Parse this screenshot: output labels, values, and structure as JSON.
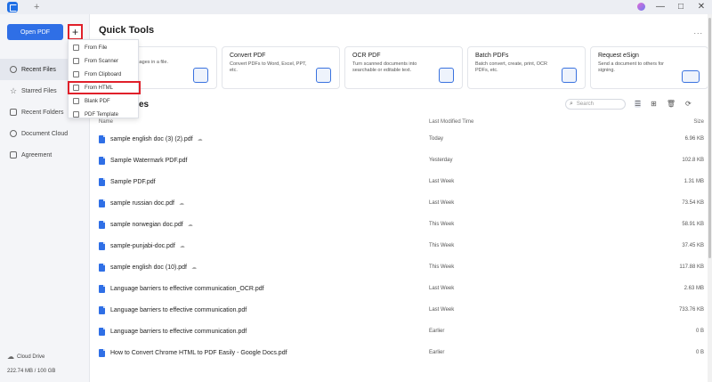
{
  "titlebar": {
    "logo_icon": "pdfelement-logo",
    "new_tab": "+",
    "win_buttons": [
      "—",
      "□",
      "✕"
    ]
  },
  "sidebar": {
    "open_pdf": "Open PDF",
    "plus": "+",
    "items": [
      {
        "label": "Recent Files",
        "icon": "clock-icon",
        "active": true
      },
      {
        "label": "Starred Files",
        "icon": "star-icon"
      },
      {
        "label": "Recent Folders",
        "icon": "folder-icon"
      },
      {
        "label": "Document Cloud",
        "icon": "cloud-icon"
      },
      {
        "label": "Agreement",
        "icon": "agreement-icon"
      }
    ],
    "cloud_drive": "Cloud Drive",
    "storage": "222.74 MB / 100 GB"
  },
  "dropdown": {
    "items": [
      "From File",
      "From Scanner",
      "From Clipboard",
      "From HTML",
      "Blank PDF",
      "PDF Template"
    ],
    "highlighted": "From HTML"
  },
  "quick_tools": {
    "title": "Quick Tools",
    "more": "...",
    "cards": [
      {
        "title": "",
        "desc": "mages in a file."
      },
      {
        "title": "Convert PDF",
        "desc": "Convert PDFs to Word, Excel, PPT, etc."
      },
      {
        "title": "OCR PDF",
        "desc": "Turn scanned documents into searchable or editable text."
      },
      {
        "title": "Batch PDFs",
        "desc": "Batch convert, create, print, OCR PDFs, etc."
      },
      {
        "title": "Request eSign",
        "desc": "Send a document to others for signing."
      }
    ]
  },
  "recent": {
    "title": "es",
    "search_placeholder": "Search",
    "columns": {
      "name": "Name",
      "modified": "Last Modified Time",
      "size": "Size"
    },
    "files": [
      {
        "name": "sample english doc (3) (2).pdf",
        "cloud": true,
        "modified": "Today",
        "size": "6.96 KB"
      },
      {
        "name": "Sample Watermark PDF.pdf",
        "cloud": false,
        "modified": "Yesterday",
        "size": "102.8 KB"
      },
      {
        "name": "Sample PDF.pdf",
        "cloud": false,
        "modified": "Last Week",
        "size": "1.31 MB"
      },
      {
        "name": "sample russian doc.pdf",
        "cloud": true,
        "modified": "Last Week",
        "size": "73.54 KB"
      },
      {
        "name": "sample norwegian doc.pdf",
        "cloud": true,
        "modified": "This Week",
        "size": "58.91 KB"
      },
      {
        "name": "sample-punjabi-doc.pdf",
        "cloud": true,
        "modified": "This Week",
        "size": "37.45 KB"
      },
      {
        "name": "sample english doc (10).pdf",
        "cloud": true,
        "modified": "This Week",
        "size": "117.88 KB"
      },
      {
        "name": "Language barriers to effective communication_OCR.pdf",
        "cloud": false,
        "modified": "Last Week",
        "size": "2.63 MB"
      },
      {
        "name": "Language barriers to effective communication.pdf",
        "cloud": false,
        "modified": "Last Week",
        "size": "733.76 KB"
      },
      {
        "name": "Language barriers to effective communication.pdf",
        "cloud": false,
        "modified": "Earlier",
        "size": "0 B"
      },
      {
        "name": "How to Convert Chrome HTML to PDF Easily - Google Docs.pdf",
        "cloud": false,
        "modified": "Earlier",
        "size": "0 B"
      }
    ]
  },
  "colors": {
    "accent": "#2f6fe6",
    "highlight": "#e0202a"
  }
}
